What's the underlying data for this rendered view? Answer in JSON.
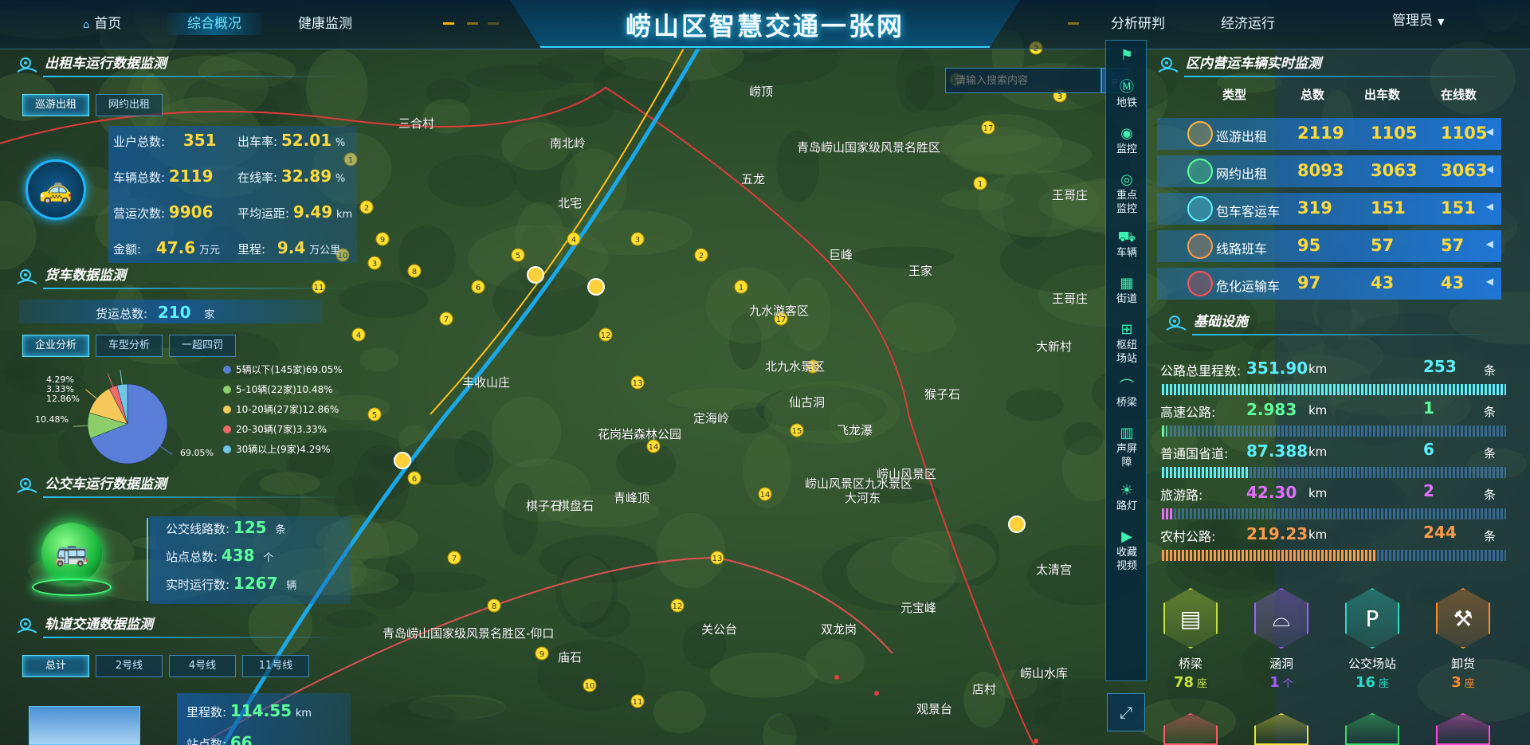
{
  "header": {
    "title": "崂山区智慧交通一张网",
    "nav_left": [
      {
        "label": "首页"
      },
      {
        "label": "综合概况"
      },
      {
        "label": "健康监测"
      }
    ],
    "nav_right": [
      {
        "label": "分析研判"
      },
      {
        "label": "经济运行"
      }
    ],
    "user": "管理员",
    "active_nav": "综合概况"
  },
  "taxi": {
    "title": "出租车运行数据监测",
    "tabs": [
      {
        "label": "巡游出租"
      },
      {
        "label": "网约出租"
      }
    ],
    "rows": [
      {
        "l1": "业户总数:",
        "v1": "351",
        "l2": "出车率:",
        "v2": "52.01",
        "u2": "%"
      },
      {
        "l1": "车辆总数:",
        "v1": "2119",
        "l2": "在线率:",
        "v2": "32.89",
        "u2": "%"
      },
      {
        "l1": "营运次数:",
        "v1": "9906",
        "l2": "平均运距:",
        "v2": "9.49",
        "u2": "km"
      },
      {
        "l1": "金额:",
        "v1": "47.6",
        "u1": "万元",
        "l2": "里程:",
        "v2": "9.4",
        "u2": "万公里"
      }
    ]
  },
  "truck": {
    "title": "货车数据监测",
    "total_label": "货运总数:",
    "total_value": "210",
    "total_unit": "家",
    "tabs": [
      {
        "label": "企业分析"
      },
      {
        "label": "车型分析"
      },
      {
        "label": "一超四罚"
      }
    ]
  },
  "chart_data": {
    "type": "pie",
    "categories": [
      "5辆以下(145家)69.05%",
      "5-10辆(22家)10.48%",
      "10-20辆(27家)12.86%",
      "20-30辆(7家)3.33%",
      "30辆以上(9家)4.29%"
    ],
    "values": [
      69.05,
      10.48,
      12.86,
      3.33,
      4.29
    ],
    "slice_labels": [
      "69.05%",
      "10.48%",
      "12.86%",
      "3.33%",
      "4.29%"
    ],
    "colors": [
      "#5b7fd8",
      "#8ccf6a",
      "#f7c95a",
      "#ef6a6a",
      "#6ec6e8"
    ],
    "legend_placement": "right"
  },
  "bus": {
    "title": "公交车运行数据监测",
    "rows": [
      {
        "label": "公交线路数:",
        "value": "125",
        "unit": "条"
      },
      {
        "label": "站点总数:",
        "value": "438",
        "unit": "个"
      },
      {
        "label": "实时运行数:",
        "value": "1267",
        "unit": "辆"
      }
    ]
  },
  "rail": {
    "title": "轨道交通数据监测",
    "tabs": [
      {
        "label": "总计"
      },
      {
        "label": "2号线"
      },
      {
        "label": "4号线"
      },
      {
        "label": "11号线"
      }
    ],
    "mileage_label": "里程数:",
    "mileage_value": "114.55",
    "mileage_unit": "km",
    "station_label": "站点数:",
    "station_value": "66"
  },
  "search": {
    "placeholder": "请输入搜索内容"
  },
  "sidebar": [
    {
      "label": "",
      "icon": "traffic-light-icon"
    },
    {
      "label": "地铁",
      "icon": "metro-icon"
    },
    {
      "label": "监控",
      "icon": "camera-icon"
    },
    {
      "label": "重点监控",
      "icon": "key-camera-icon"
    },
    {
      "label": "车辆",
      "icon": "car-icon"
    },
    {
      "label": "街道",
      "icon": "street-icon"
    },
    {
      "label": "枢纽场站",
      "icon": "hub-icon"
    },
    {
      "label": "桥梁",
      "icon": "bridge-icon"
    },
    {
      "label": "声屏障",
      "icon": "sound-barrier-icon"
    },
    {
      "label": "路灯",
      "icon": "street-lamp-icon"
    },
    {
      "label": "收藏视频",
      "icon": "favorite-video-icon"
    }
  ],
  "vehicles": {
    "title": "区内营运车辆实时监测",
    "headers": [
      "类型",
      "总数",
      "出车数",
      "在线数"
    ],
    "rows": [
      {
        "type": "巡游出租",
        "total": "2119",
        "out": "1105",
        "online": "1105",
        "color": "#ffb340"
      },
      {
        "type": "网约出租",
        "total": "8093",
        "out": "3063",
        "online": "3063",
        "color": "#5cff9a"
      },
      {
        "type": "包车客运车",
        "total": "319",
        "out": "151",
        "online": "151",
        "color": "#5cf0ff"
      },
      {
        "type": "线路班车",
        "total": "95",
        "out": "57",
        "online": "57",
        "color": "#ff9a4a"
      },
      {
        "type": "危化运输车",
        "total": "97",
        "out": "43",
        "online": "43",
        "color": "#ff5050"
      }
    ]
  },
  "infra": {
    "title": "基础设施",
    "rows": [
      {
        "label": "公路总里程数:",
        "value": "351.90",
        "unit": "km",
        "count": "253",
        "cunit": "条",
        "color": "#5cf0ff",
        "fill": 1.0
      },
      {
        "label": "高速公路:",
        "value": "2.983",
        "unit": "km",
        "count": "1",
        "cunit": "条",
        "color": "#5cff9a",
        "fill": 0.01
      },
      {
        "label": "普通国省道:",
        "value": "87.388",
        "unit": "km",
        "count": "6",
        "cunit": "条",
        "color": "#5cf0ff",
        "fill": 0.25
      },
      {
        "label": "旅游路:",
        "value": "42.30",
        "unit": "km",
        "count": "2",
        "cunit": "条",
        "color": "#e070ff",
        "fill": 0.03
      },
      {
        "label": "农村公路:",
        "value": "219.23",
        "unit": "km",
        "count": "244",
        "cunit": "条",
        "color": "#ff9a4a",
        "fill": 0.62
      }
    ],
    "facilities": [
      {
        "label": "桥梁",
        "value": "78",
        "unit": "座",
        "color": "#c7e23a"
      },
      {
        "label": "涵洞",
        "value": "1",
        "unit": "个",
        "color": "#a45cff"
      },
      {
        "label": "公交场站",
        "value": "16",
        "unit": "座",
        "color": "#2fd6c8"
      },
      {
        "label": "卸货",
        "value": "3",
        "unit": "座",
        "color": "#ff8a2a"
      }
    ]
  },
  "map": {
    "labels": [
      "青岛崂山国家级风景名胜区-仰口",
      "崂山风景区九水景区",
      "花岗岩森林公园",
      "北九水景区",
      "青岛崂山国家级风景名胜区",
      "北宅",
      "仙古洞",
      "定海岭",
      "棋盘石",
      "王哥庄",
      "王家",
      "关公台",
      "双龙岗",
      "飞龙瀑",
      "九水游客区",
      "崂山风景区",
      "店村",
      "丰收山庄",
      "三合村",
      "巨峰",
      "太清宫",
      "大河东",
      "棋子石",
      "崂山水库",
      "元宝峰",
      "庙石",
      "五龙",
      "王哥庄",
      "观景台",
      "大新村",
      "南北岭",
      "崂顶",
      "青峰顶",
      "猴子石"
    ],
    "markers": [
      "1",
      "2",
      "3",
      "4",
      "5",
      "6",
      "7",
      "8",
      "9",
      "10",
      "11",
      "12",
      "13",
      "14",
      "15",
      "16",
      "17"
    ]
  }
}
